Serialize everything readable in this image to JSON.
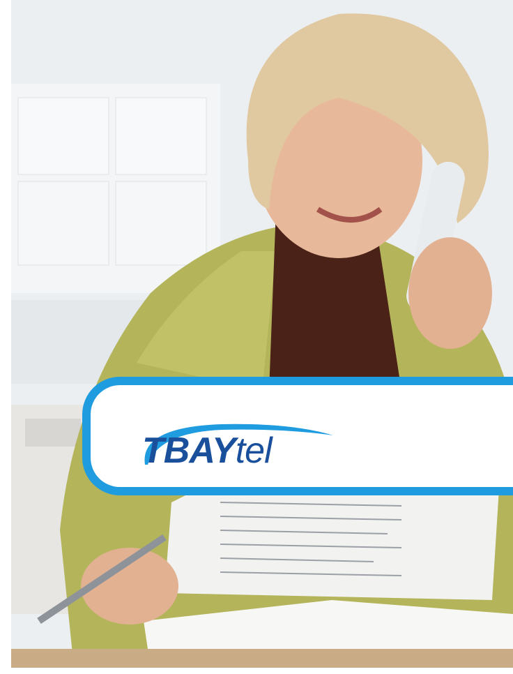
{
  "brand": {
    "name_bold": "TBAY",
    "name_light": "tel",
    "border_color": "#1f9be0",
    "text_color": "#1a4f9c"
  },
  "photo": {
    "description_icon": "woman-on-phone-photo"
  }
}
